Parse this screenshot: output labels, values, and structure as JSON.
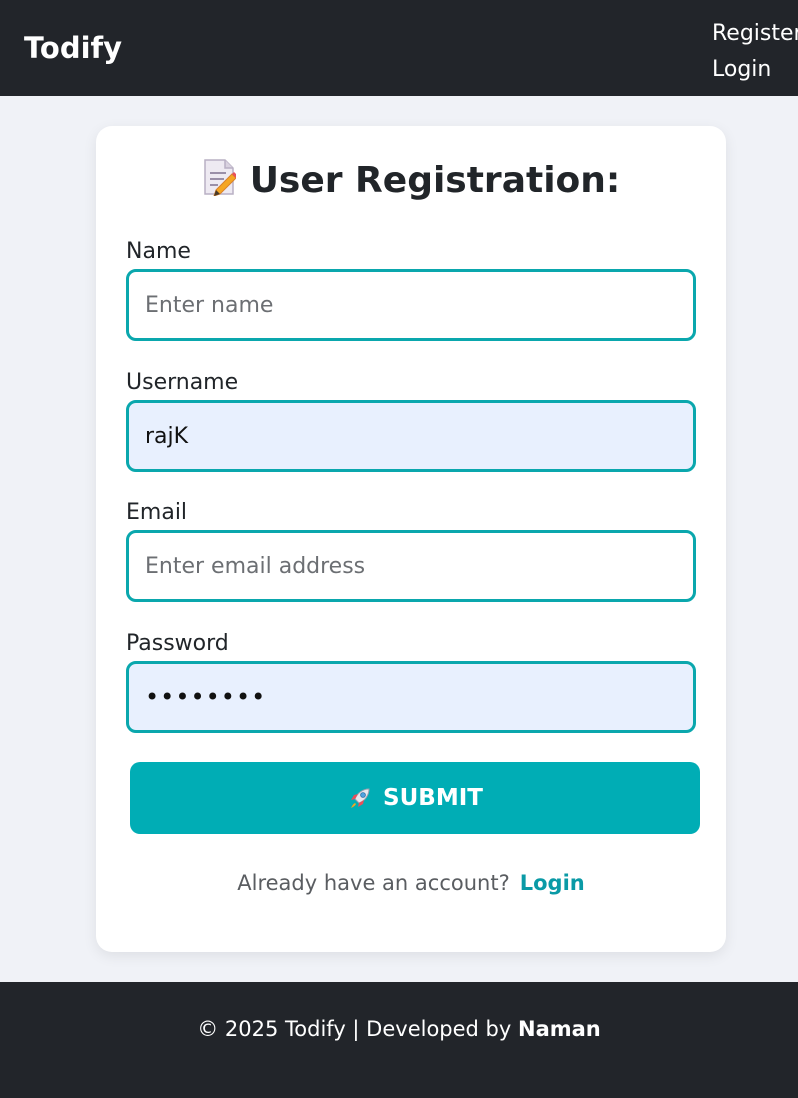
{
  "navbar": {
    "brand": "Todify",
    "links": [
      "Register",
      "Login"
    ]
  },
  "form": {
    "title": "User Registration:",
    "title_icon": "memo-icon",
    "fields": [
      {
        "label": "Name",
        "placeholder": "Enter name",
        "value": ""
      },
      {
        "label": "Username",
        "placeholder": "",
        "value": "rajK"
      },
      {
        "label": "Email",
        "placeholder": "Enter email address",
        "value": ""
      },
      {
        "label": "Password",
        "placeholder": "",
        "value": "••••••••"
      }
    ],
    "submit_label": "SUBMIT",
    "submit_icon": "rocket-icon",
    "login_prompt": "Already have an account?",
    "login_link": "Login"
  },
  "footer": {
    "text": "© 2025 Todify | Developed by",
    "author": "Naman"
  },
  "colors": {
    "accent": "#00adb5",
    "input_border": "#0aa7ad",
    "navbar_bg": "#22252a",
    "page_bg": "#f0f2f7",
    "autofill_bg": "#e8f0fe"
  }
}
